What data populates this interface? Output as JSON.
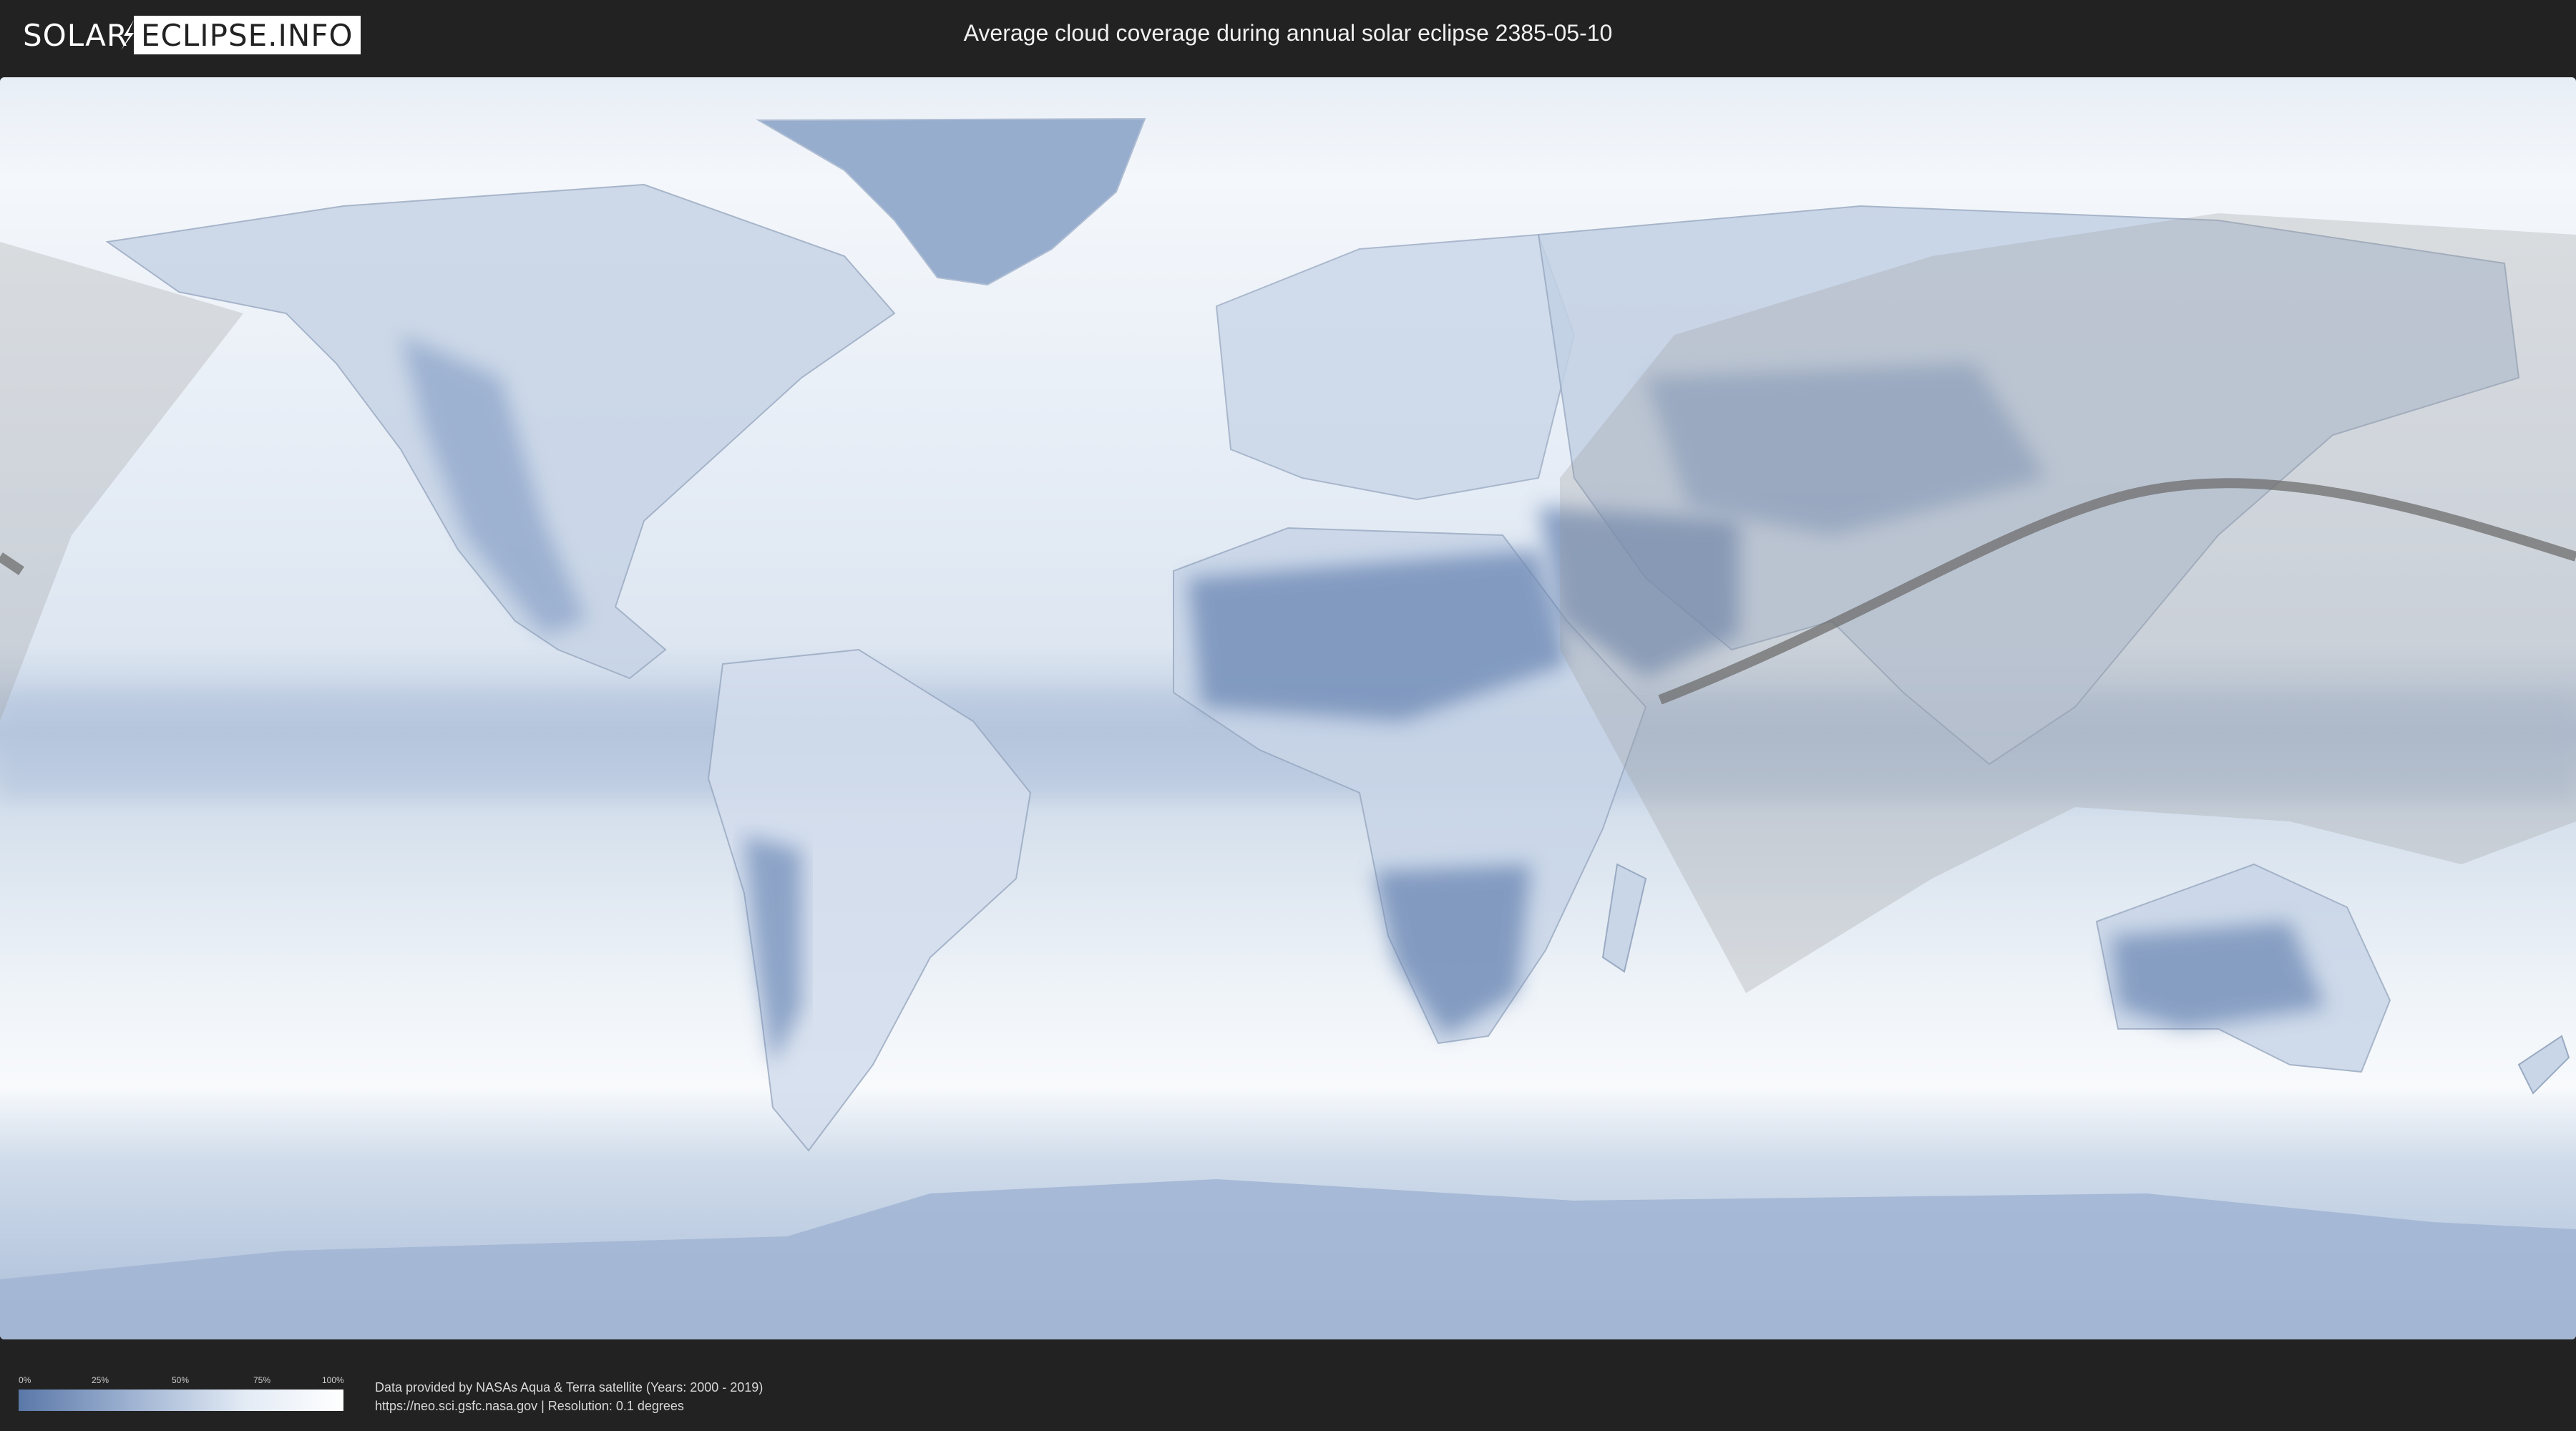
{
  "header": {
    "logo_left": "SOLAR",
    "logo_right": "ECLIPSE.INFO",
    "title": "Average cloud coverage during annual solar eclipse 2385-05-10"
  },
  "map": {
    "kind": "world cloud coverage map (equirectangular)",
    "ocean_color": "#e4ecf5",
    "land_color": "#b9c9e0",
    "cloudy_color": "#ffffff",
    "clear_color": "#5a78a8",
    "eclipse_overlay_color": "#a0a0a0",
    "central_path_color": "#6e6e6e"
  },
  "legend": {
    "ticks": [
      "0%",
      "25%",
      "50%",
      "75%",
      "100%"
    ]
  },
  "credits": {
    "line1": "Data provided by NASAs Aqua & Terra satellite (Years: 2000 - 2019)",
    "line2": "https://neo.sci.gsfc.nasa.gov | Resolution: 0.1 degrees"
  }
}
